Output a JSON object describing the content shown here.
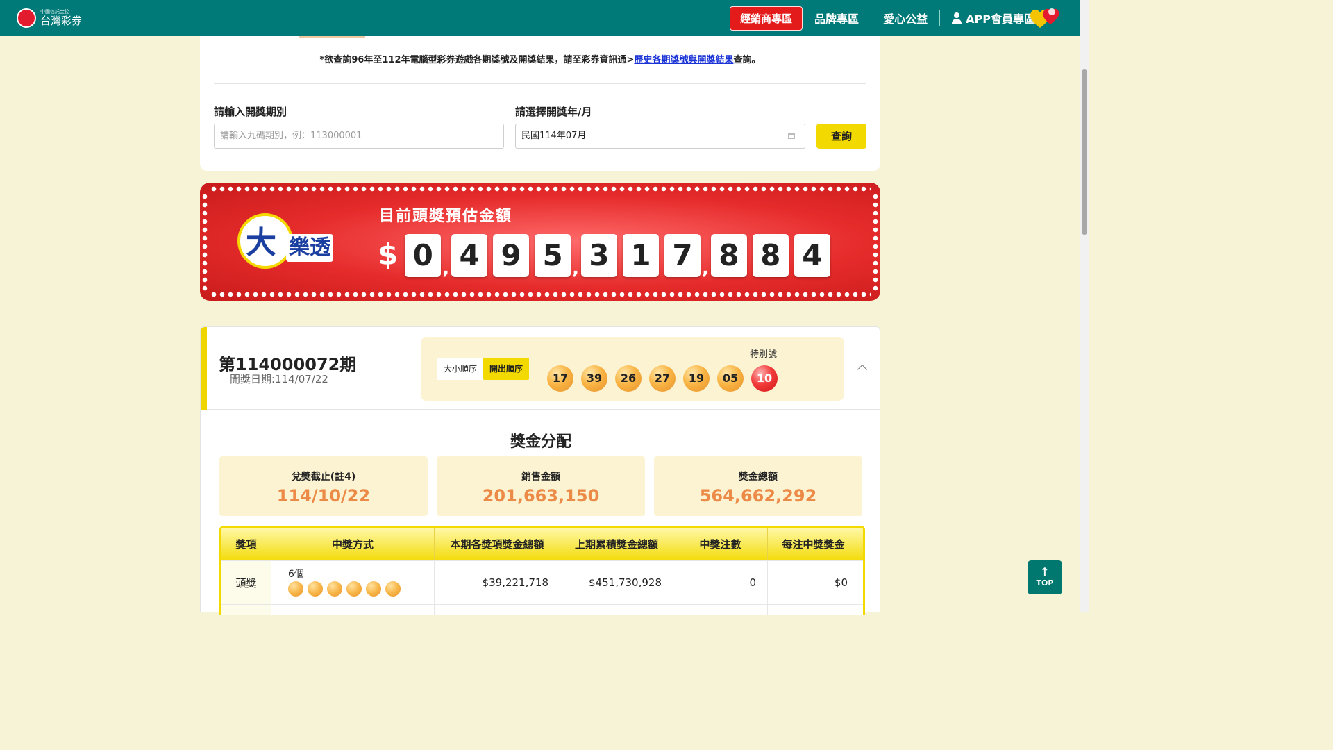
{
  "header": {
    "logo_small": "中國信託金控",
    "logo_big": "台灣彩券",
    "nav": {
      "dealer": "經銷商專區",
      "brand": "品牌專區",
      "charity": "愛心公益",
      "app_member": "APP會員專區"
    }
  },
  "search": {
    "notice_prefix": "*欲查詢96年至112年電腦型彩券遊戲各期獎號及開獎結果，請至彩券資訊通>",
    "notice_link": "歷史各期獎號與開獎結果",
    "notice_suffix": "查詢。",
    "period_label": "請輸入開獎期別",
    "period_placeholder": "請輸入九碼期別，例：113000001",
    "month_label": "請選擇開獎年/月",
    "month_value": "民國114年07月",
    "query_label": "查詢"
  },
  "jackpot": {
    "game_logo_big": "大",
    "game_logo_text": "樂透",
    "title": "目前頭獎預估金額",
    "currency": "$",
    "digits": [
      "0",
      "4",
      "9",
      "5",
      "3",
      "1",
      "7",
      "8",
      "8",
      "4"
    ],
    "comma": ","
  },
  "draw": {
    "period": "第114000072期",
    "date": "開獎日期:114/07/22",
    "sort_size": "大小順序",
    "sort_draw": "開出順序",
    "special_label": "特別號",
    "balls": [
      "17",
      "39",
      "26",
      "27",
      "19",
      "05"
    ],
    "special_ball": "10"
  },
  "prize": {
    "title": "獎金分配",
    "stats": [
      {
        "label": "兌獎截止(註4)",
        "value": "114/10/22"
      },
      {
        "label": "銷售金額",
        "value": "201,663,150"
      },
      {
        "label": "獎金總額",
        "value": "564,662,292"
      }
    ],
    "table": {
      "headers": [
        "獎項",
        "中獎方式",
        "本期各獎項獎金總額",
        "上期累積獎金總額",
        "中獎注數",
        "每注中獎獎金"
      ],
      "rows": [
        {
          "prize": "頭獎",
          "method": "6個",
          "current_total": "$39,221,718",
          "carried": "$451,730,928",
          "winners": "0",
          "per_ticket": "$0"
        }
      ]
    }
  },
  "top_button": "TOP",
  "colors": {
    "header_bg": "#007a78",
    "accent_yellow": "#f2d900",
    "dealer_red": "#e31b1b",
    "stat_orange": "#ec8a47",
    "page_bg": "#f7f3d6"
  }
}
